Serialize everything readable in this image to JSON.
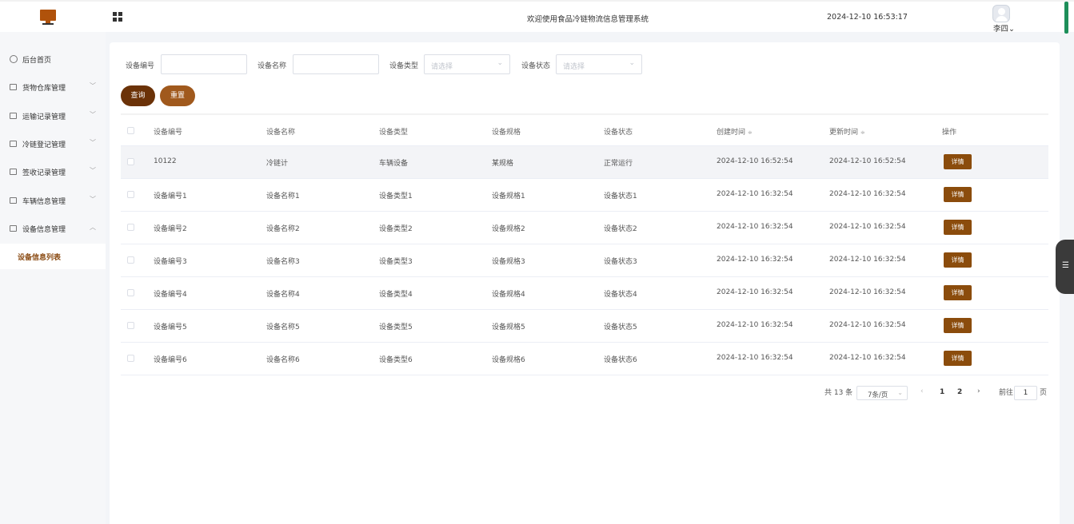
{
  "header": {
    "title": "欢迎使用食品冷链物流信息管理系统",
    "datetime": "2024-12-10 16:53:17",
    "user_name": "李四",
    "user_caret": "⌄"
  },
  "sidebar": {
    "items": [
      {
        "label": "后台首页",
        "icon": "clock-icon",
        "arrow": ""
      },
      {
        "label": "货物仓库管理",
        "icon": "menu-icon",
        "arrow": "﹀"
      },
      {
        "label": "运输记录管理",
        "icon": "menu-icon",
        "arrow": "﹀"
      },
      {
        "label": "冷链登记管理",
        "icon": "menu-icon",
        "arrow": "﹀"
      },
      {
        "label": "签收记录管理",
        "icon": "menu-icon",
        "arrow": "﹀"
      },
      {
        "label": "车辆信息管理",
        "icon": "menu-icon",
        "arrow": "﹀"
      },
      {
        "label": "设备信息管理",
        "icon": "menu-icon",
        "arrow": "︿"
      }
    ],
    "active_sub": "设备信息列表"
  },
  "filters": {
    "device_no_label": "设备编号",
    "device_name_label": "设备名称",
    "device_type_label": "设备类型",
    "device_status_label": "设备状态",
    "type_placeholder": "请选择",
    "status_placeholder": "请选择",
    "select_arrow": "⌄",
    "query_label": "查询",
    "reset_label": "重置"
  },
  "table": {
    "columns": [
      "设备编号",
      "设备名称",
      "设备类型",
      "设备规格",
      "设备状态",
      "创建时间",
      "更新时间",
      "操作"
    ],
    "sort_icon": "≑",
    "detail_label": "详情",
    "rows": [
      [
        "10122",
        "冷链计",
        "车辆设备",
        "某规格",
        "正常运行",
        "2024-12-10 16:52:54",
        "2024-12-10 16:52:54"
      ],
      [
        "设备编号1",
        "设备名称1",
        "设备类型1",
        "设备规格1",
        "设备状态1",
        "2024-12-10 16:32:54",
        "2024-12-10 16:32:54"
      ],
      [
        "设备编号2",
        "设备名称2",
        "设备类型2",
        "设备规格2",
        "设备状态2",
        "2024-12-10 16:32:54",
        "2024-12-10 16:32:54"
      ],
      [
        "设备编号3",
        "设备名称3",
        "设备类型3",
        "设备规格3",
        "设备状态3",
        "2024-12-10 16:32:54",
        "2024-12-10 16:32:54"
      ],
      [
        "设备编号4",
        "设备名称4",
        "设备类型4",
        "设备规格4",
        "设备状态4",
        "2024-12-10 16:32:54",
        "2024-12-10 16:32:54"
      ],
      [
        "设备编号5",
        "设备名称5",
        "设备类型5",
        "设备规格5",
        "设备状态5",
        "2024-12-10 16:32:54",
        "2024-12-10 16:32:54"
      ],
      [
        "设备编号6",
        "设备名称6",
        "设备类型6",
        "设备规格6",
        "设备状态6",
        "2024-12-10 16:32:54",
        "2024-12-10 16:32:54"
      ]
    ]
  },
  "pagination": {
    "total": "共 13 条",
    "page_size": "7条/页",
    "size_arrow": "⌄",
    "prev": "‹",
    "next": "›",
    "pages": [
      "1",
      "2"
    ],
    "goto_prefix": "前往",
    "goto_value": "1",
    "goto_suffix": "页"
  },
  "float_tab_icon": "☰"
}
